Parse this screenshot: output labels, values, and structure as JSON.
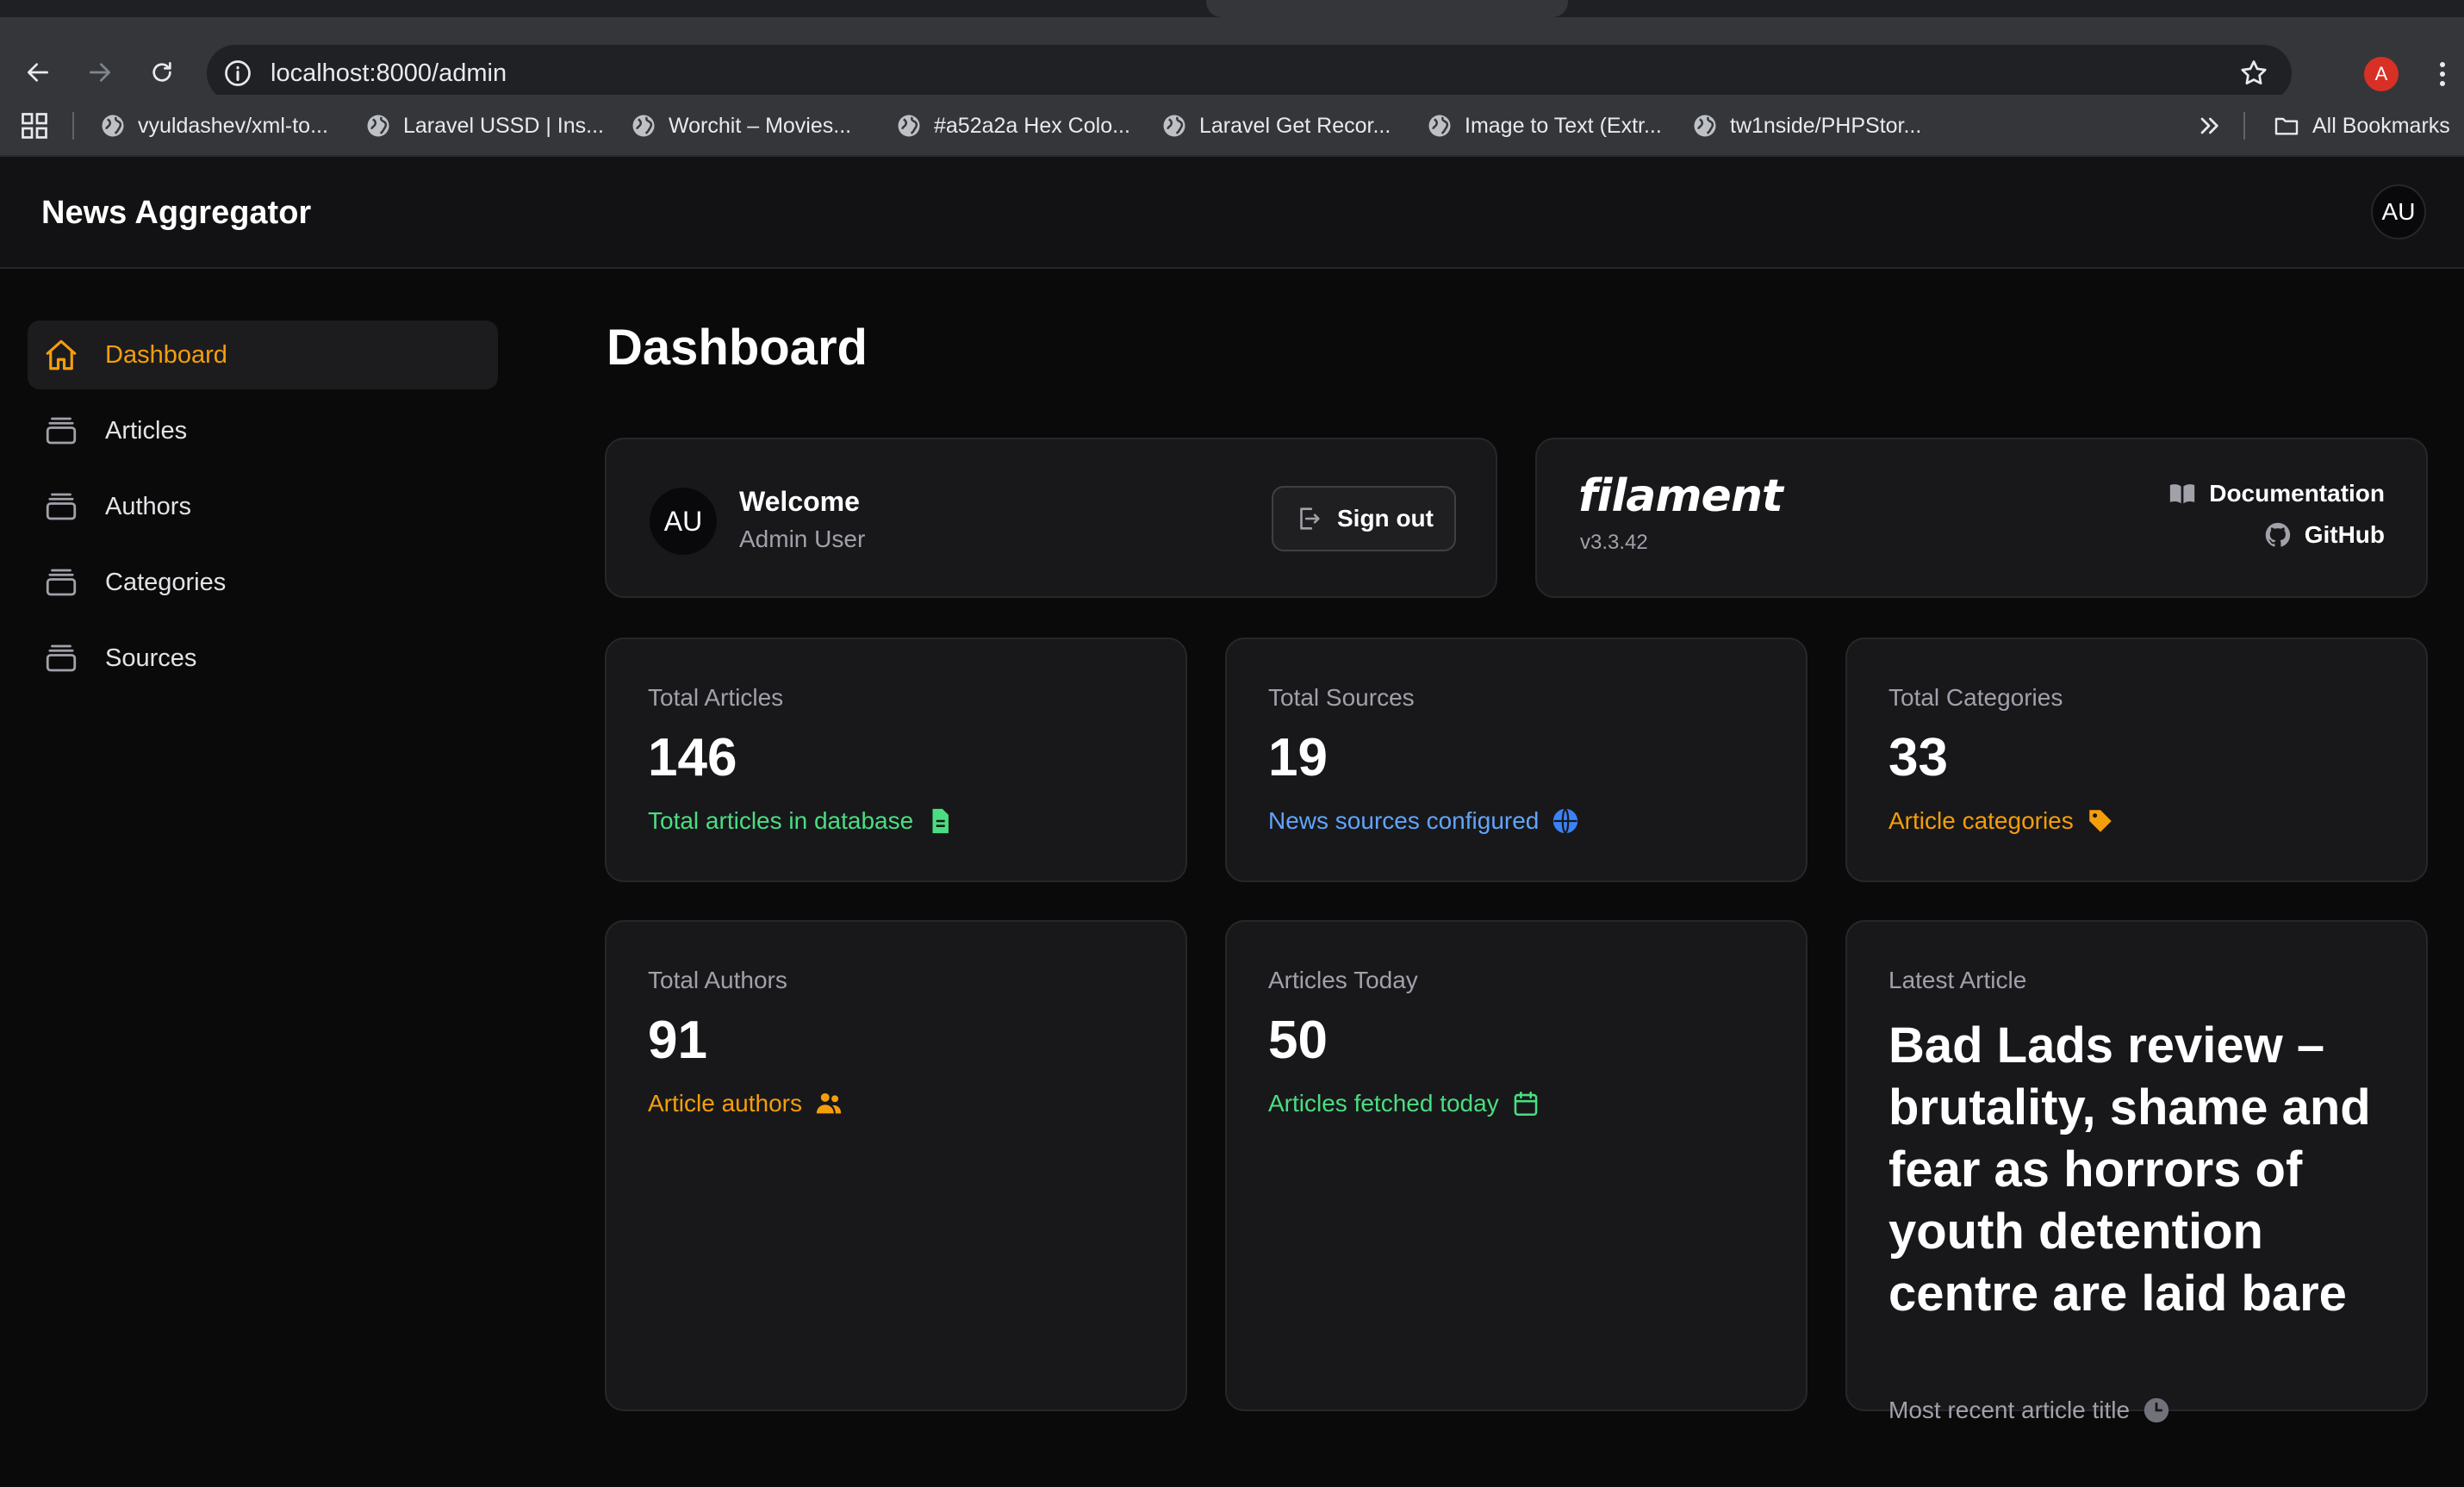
{
  "browser": {
    "url": "localhost:8000/admin",
    "profile_initial": "A",
    "bookmarks": [
      "vyuldashev/xml-to...",
      "Laravel USSD | Ins...",
      "Worchit – Movies...",
      "#a52a2a Hex Colo...",
      "Laravel Get Recor...",
      "Image to Text (Extr...",
      "tw1nside/PHPStor..."
    ],
    "all_bookmarks": "All Bookmarks"
  },
  "header": {
    "brand": "News Aggregator",
    "user_initials": "AU"
  },
  "sidebar": {
    "items": [
      {
        "label": "Dashboard",
        "icon": "home-icon",
        "active": true
      },
      {
        "label": "Articles",
        "icon": "stack-icon"
      },
      {
        "label": "Authors",
        "icon": "stack-icon"
      },
      {
        "label": "Categories",
        "icon": "stack-icon"
      },
      {
        "label": "Sources",
        "icon": "stack-icon"
      }
    ]
  },
  "main": {
    "title": "Dashboard",
    "welcome": {
      "initials": "AU",
      "title": "Welcome",
      "user": "Admin User",
      "signout_label": "Sign out"
    },
    "filament": {
      "logo": "filament",
      "version": "v3.3.42",
      "docs_label": "Documentation",
      "github_label": "GitHub"
    },
    "stats": [
      {
        "label": "Total Articles",
        "value": "146",
        "desc": "Total articles in database",
        "color": "#4ade80",
        "icon": "document-icon"
      },
      {
        "label": "Total Sources",
        "value": "19",
        "desc": "News sources configured",
        "color": "#60a5fa",
        "icon": "globe-icon"
      },
      {
        "label": "Total Categories",
        "value": "33",
        "desc": "Article categories",
        "color": "#f59e0b",
        "icon": "tag-icon"
      },
      {
        "label": "Total Authors",
        "value": "91",
        "desc": "Article authors",
        "color": "#f59e0b",
        "icon": "users-icon"
      },
      {
        "label": "Articles Today",
        "value": "50",
        "desc": "Articles fetched today",
        "color": "#4ade80",
        "icon": "calendar-icon"
      },
      {
        "label": "Latest Article",
        "value": "Bad Lads review – brutality, shame and fear as horrors of youth detention centre are laid bare",
        "desc": "Most recent article title",
        "color": "#a1a1aa",
        "icon": "clock-icon"
      }
    ]
  }
}
